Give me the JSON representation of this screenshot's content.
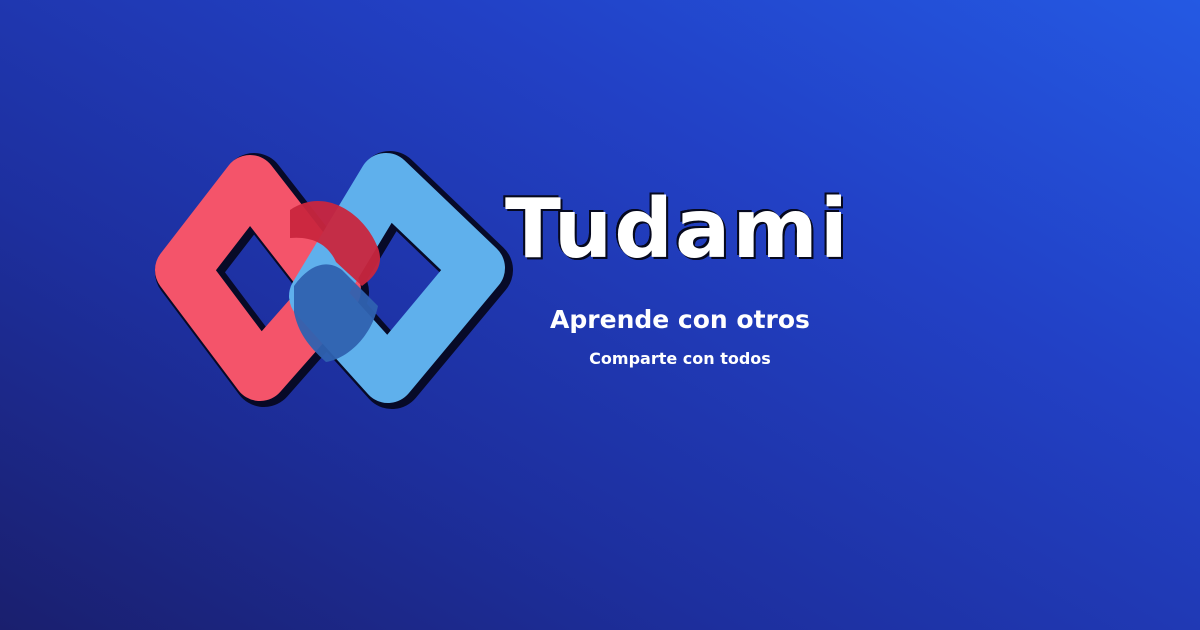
{
  "brand": {
    "name": "Tudami",
    "tagline_primary": "Aprende con otros",
    "tagline_secondary": "Comparte con todos"
  },
  "logo": {
    "icon": "linked-chain-icon",
    "colors": {
      "red_link": "#f4546a",
      "blue_link": "#5fb0ec",
      "overlap_red": "#c9263e",
      "overlap_blue": "#2f62b0",
      "outline": "#05061a"
    }
  },
  "colors": {
    "background_start": "#2459e3",
    "background_end": "#1a1f6e",
    "text": "#ffffff"
  }
}
